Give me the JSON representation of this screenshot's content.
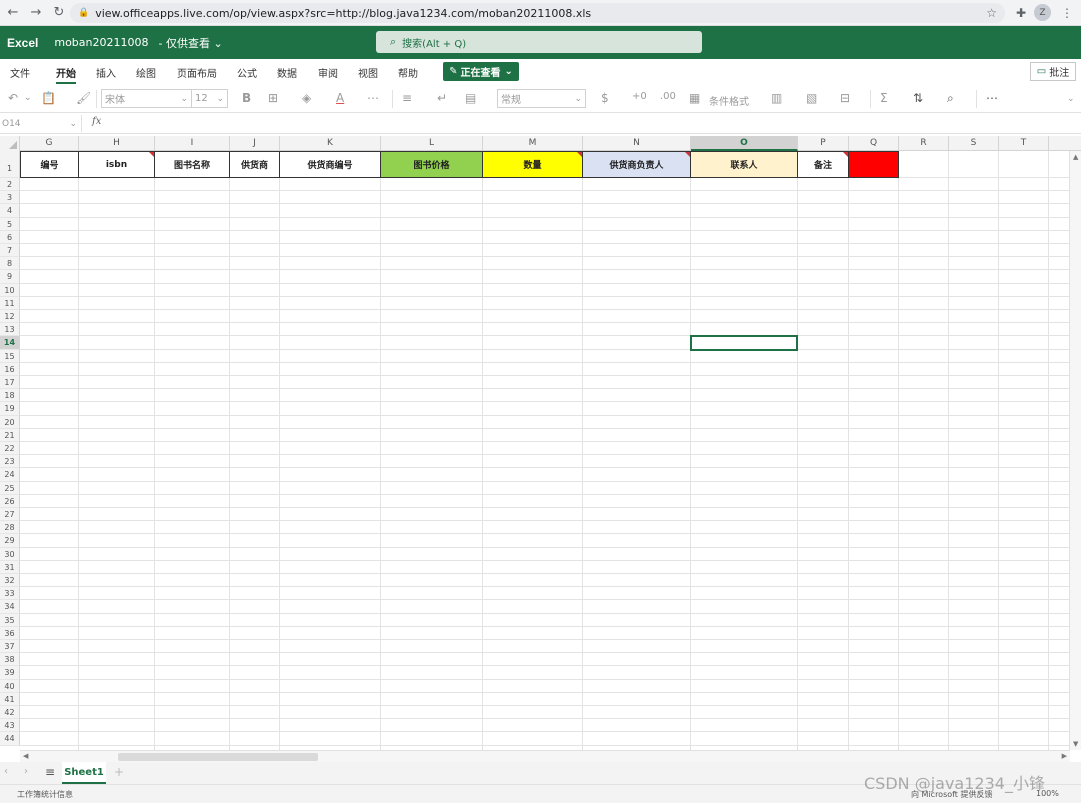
{
  "browser": {
    "url": "view.officeapps.live.com/op/view.aspx?src=http://blog.java1234.com/moban20211008.xls",
    "avatar_initial": "Z"
  },
  "app": {
    "name": "Excel",
    "doc_name": "moban20211008",
    "mode": "- 仅供查看 ⌄",
    "search_placeholder": "搜索(Alt + Q)",
    "brand_color": "#1e7145"
  },
  "ribbon": {
    "tabs": [
      "文件",
      "开始",
      "插入",
      "绘图",
      "页面布局",
      "公式",
      "数据",
      "审阅",
      "视图",
      "帮助"
    ],
    "active_tab": "开始",
    "view_button": "正在查看",
    "comment_button": "批注"
  },
  "toolbar": {
    "font": "宋体",
    "font_size": "12",
    "number_format": "常规",
    "conditional_format": "条件格式"
  },
  "formula_bar": {
    "name_box": "O14",
    "fx": "fx"
  },
  "sheet": {
    "columns": [
      "G",
      "H",
      "I",
      "J",
      "K",
      "L",
      "M",
      "N",
      "O",
      "P",
      "Q",
      "R",
      "S",
      "T"
    ],
    "selected_column": "O",
    "selected_row": "14",
    "row_count": 44,
    "headers": [
      {
        "text": "编号",
        "color": "#ffffff",
        "comment": false
      },
      {
        "text": "isbn",
        "color": "#ffffff",
        "comment": true
      },
      {
        "text": "图书名称",
        "color": "#ffffff",
        "comment": false
      },
      {
        "text": "供货商",
        "color": "#ffffff",
        "comment": false
      },
      {
        "text": "供货商编号",
        "color": "#ffffff",
        "comment": false
      },
      {
        "text": "图书价格",
        "color": "#92d050",
        "comment": false
      },
      {
        "text": "数量",
        "color": "#ffff00",
        "comment": true
      },
      {
        "text": "供货商负责人",
        "color": "#d9e1f2",
        "comment": true
      },
      {
        "text": "联系人",
        "color": "#fff2cc",
        "comment": false
      },
      {
        "text": "备注",
        "color": "#ffffff",
        "comment": true
      },
      {
        "text": "",
        "color": "#ff0000",
        "comment": false
      }
    ]
  },
  "sheet_tabs": {
    "active": "Sheet1"
  },
  "status": {
    "left": "工作簿统计信息",
    "right": "向 Microsoft 提供反馈",
    "zoom": "100%"
  },
  "watermark": "CSDN @java1234_小锋"
}
